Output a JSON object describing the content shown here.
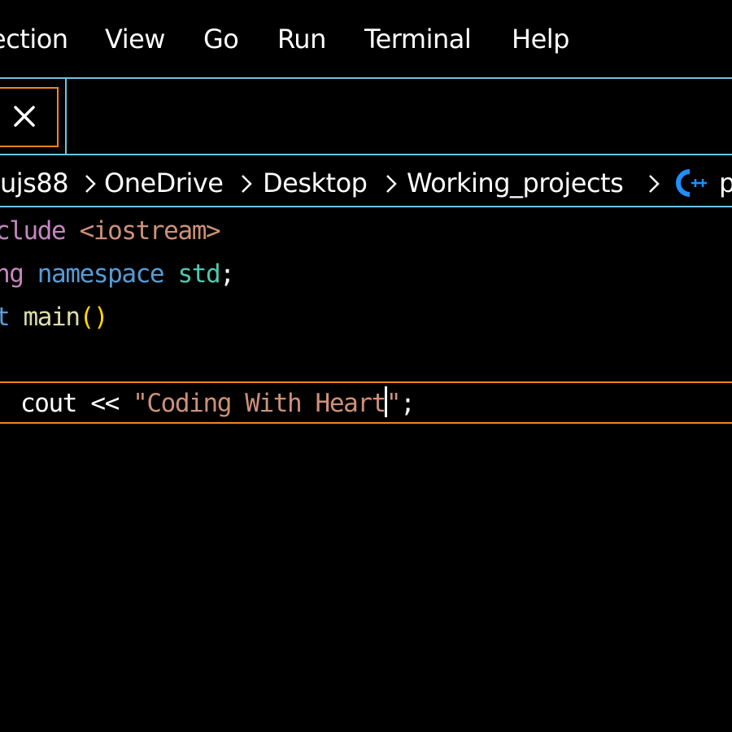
{
  "menu": {
    "items": [
      {
        "label": "ection"
      },
      {
        "label": "View"
      },
      {
        "label": "Go"
      },
      {
        "label": "Run"
      },
      {
        "label": "Terminal"
      },
      {
        "label": "Help"
      }
    ]
  },
  "tabs": {
    "close_icon": "close-icon"
  },
  "breadcrumb": {
    "items": [
      "ujs88",
      "OneDrive",
      "Desktop",
      "Working_projects",
      "p"
    ],
    "file_icon": "cpp-file-icon"
  },
  "editor": {
    "lines": [
      {
        "parts": [
          {
            "t": "clude",
            "k": "keyword"
          },
          {
            "t": " ",
            "k": "plain"
          },
          {
            "t": "<iostream>",
            "k": "string"
          }
        ]
      },
      {
        "parts": [
          {
            "t": "ng",
            "k": "keyword"
          },
          {
            "t": " ",
            "k": "plain"
          },
          {
            "t": "namespace",
            "k": "decl"
          },
          {
            "t": " ",
            "k": "plain"
          },
          {
            "t": "std",
            "k": "ns"
          },
          {
            "t": ";",
            "k": "plain"
          }
        ]
      },
      {
        "parts": [
          {
            "t": "t",
            "k": "decl"
          },
          {
            "t": " ",
            "k": "plain"
          },
          {
            "t": "main",
            "k": "func"
          },
          {
            "t": "()",
            "k": "paren"
          }
        ]
      },
      {
        "parts": []
      },
      {
        "parts": [
          {
            "t": "cout",
            "k": "plain"
          },
          {
            "t": " << ",
            "k": "plain"
          },
          {
            "t": "\"Coding With Heart",
            "k": "string"
          },
          {
            "t": "|CURSOR|",
            "k": "cursor"
          },
          {
            "t": "\"",
            "k": "string"
          },
          {
            "t": ";",
            "k": "plain"
          }
        ]
      }
    ]
  },
  "colors": {
    "accent_border": "#6fc3df",
    "focus_border": "#f38518",
    "keyword": "#c586c0",
    "string": "#ce9178",
    "decl": "#569cd6",
    "namespace": "#4ec9b0",
    "function": "#dcdcaa"
  }
}
